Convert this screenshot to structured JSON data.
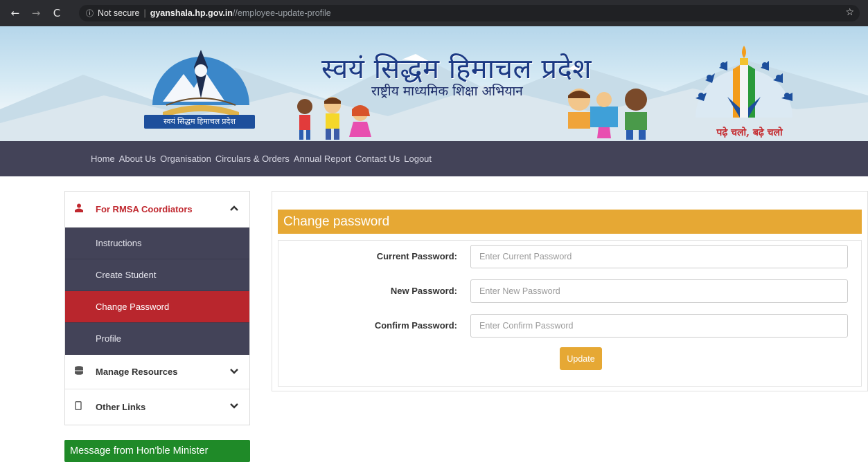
{
  "browser": {
    "back_icon": "arrow-left-icon",
    "forward_icon": "arrow-right-icon",
    "reload_icon": "reload-icon",
    "security_label": "Not secure",
    "host": "gyanshala.hp.gov.in",
    "path": "//employee-update-profile",
    "star_icon": "bookmark-star-icon"
  },
  "banner": {
    "title": "स्वयं सिद्धम हिमाचल प्रदेश",
    "subtitle": "राष्ट्रीय माध्यमिक शिक्षा अभियान",
    "logo_left_text": "स्वयं सिद्धम हिमाचल प्रदेश",
    "logo_right_text": "पढ़े चलो, बढ़े चलो"
  },
  "nav": {
    "items": [
      {
        "label": "Home"
      },
      {
        "label": "About Us"
      },
      {
        "label": "Organisation"
      },
      {
        "label": "Circulars & Orders"
      },
      {
        "label": "Annual Report"
      },
      {
        "label": "Contact Us"
      },
      {
        "label": "Logout"
      }
    ]
  },
  "sidebar": {
    "coordinators": {
      "label": "For RMSA Coordiators",
      "icon": "user-icon",
      "chevron": "chevron-up-icon"
    },
    "sub_items": [
      {
        "label": "Instructions",
        "active": false
      },
      {
        "label": "Create Student",
        "active": false
      },
      {
        "label": "Change Password",
        "active": true
      },
      {
        "label": "Profile",
        "active": false
      }
    ],
    "manage_resources": {
      "label": "Manage Resources",
      "icon": "database-icon",
      "chevron": "chevron-down-icon"
    },
    "other_links": {
      "label": "Other Links",
      "icon": "mobile-icon",
      "chevron": "chevron-down-icon"
    }
  },
  "minister_button": {
    "label": "Message from Hon'ble Minister"
  },
  "form": {
    "header": "Change password",
    "fields": [
      {
        "label": "Current Password:",
        "placeholder": "Enter Current Password",
        "value": ""
      },
      {
        "label": "New Password:",
        "placeholder": "Enter New Password",
        "value": ""
      },
      {
        "label": "Confirm Password:",
        "placeholder": "Enter Confirm Password",
        "value": ""
      }
    ],
    "submit_label": "Update"
  },
  "colors": {
    "nav_bg": "#434358",
    "accent_red": "#b9262d",
    "form_header": "#e6a834",
    "minister_green": "#1f8a28"
  }
}
